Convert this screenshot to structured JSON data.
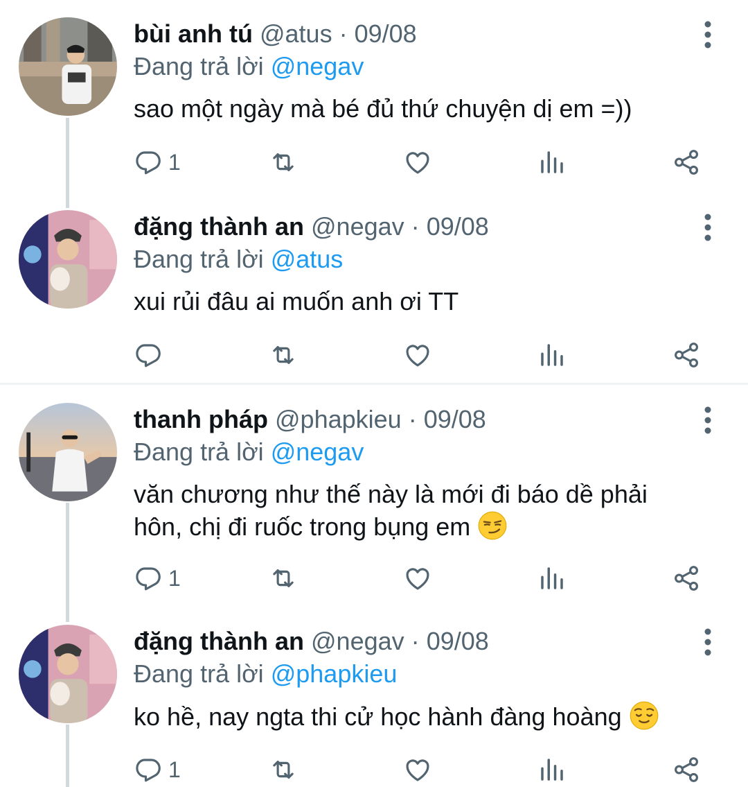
{
  "tweets": [
    {
      "name": "bùi anh tú",
      "handle": "@atus",
      "dot": "·",
      "date": "09/08",
      "reply_prefix": "Đang trả lời",
      "reply_to": "@negav",
      "text_lines": [
        "sao một ngày mà bé đủ thứ chuyện dị em =))"
      ],
      "reply_count": "1"
    },
    {
      "name": "đặng thành an",
      "handle": "@negav",
      "dot": "·",
      "date": "09/08",
      "reply_prefix": "Đang trả lời",
      "reply_to": "@atus",
      "text_lines": [
        "xui rủi đâu ai muốn anh ơi TT"
      ],
      "reply_count": ""
    },
    {
      "name": "thanh pháp",
      "handle": "@phapkieu",
      "dot": "·",
      "date": "09/08",
      "reply_prefix": "Đang trả lời",
      "reply_to": "@negav",
      "text_lines": [
        "văn chương như thế này là mới đi báo dề phải",
        "hôn, chị đi ruốc trong bụng em"
      ],
      "emoji": "smirking-face",
      "reply_count": "1"
    },
    {
      "name": "đặng thành an",
      "handle": "@negav",
      "dot": "·",
      "date": "09/08",
      "reply_prefix": "Đang trả lời",
      "reply_to": "@phapkieu",
      "text_lines": [
        "ko hề, nay ngta thi cử học hành đàng hoàng"
      ],
      "emoji": "relieved-face",
      "reply_count": "1"
    }
  ],
  "colors": {
    "text": "#0f1419",
    "muted": "#536471",
    "link": "#1d9bf0",
    "thread_line": "#cfd9de",
    "divider": "#eff3f4"
  },
  "icons": [
    "reply-icon",
    "retweet-icon",
    "like-icon",
    "analytics-icon",
    "share-icon",
    "more-options-icon"
  ]
}
